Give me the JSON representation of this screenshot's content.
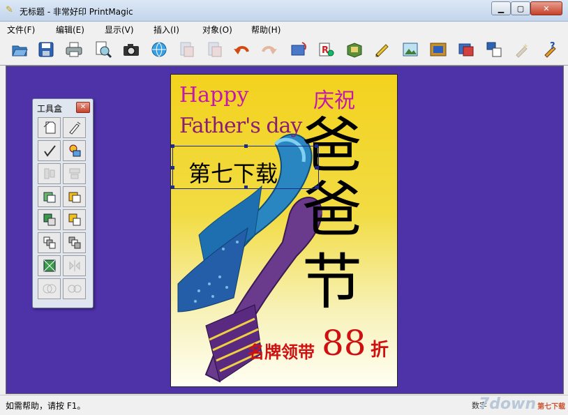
{
  "window": {
    "title": "无标题 - 非常好印 PrintMagic",
    "app_icon": "printmagic-app-icon"
  },
  "menu": {
    "items": [
      "文件(F)",
      "编辑(E)",
      "显示(V)",
      "插入(I)",
      "对象(O)",
      "帮助(H)"
    ]
  },
  "toolbar": {
    "buttons": [
      "open-icon",
      "save-icon",
      "print-icon",
      "print-preview-icon",
      "camera-icon",
      "web-icon",
      "cut-icon",
      "copy-icon",
      "undo-icon",
      "redo-icon",
      "rotate-icon",
      "text-effect-icon",
      "calendar-icon",
      "edit-icon",
      "image-icon",
      "frame-icon",
      "photo-icon",
      "layout-icon",
      "wizard-icon",
      "help-icon"
    ]
  },
  "toolbox": {
    "title": "工具盒",
    "tools": [
      "select-icon",
      "pen-icon",
      "line-icon",
      "shape-icon",
      "align-left-icon",
      "align-top-icon",
      "group-icon",
      "ungroup-icon",
      "bring-front-icon",
      "send-back-icon",
      "forward-icon",
      "backward-icon",
      "crop-icon",
      "flip-icon",
      "merge-icon",
      "split-icon"
    ]
  },
  "canvas": {
    "happy": "Happy",
    "qingzhu": "庆祝",
    "fathers_day": "Father's day",
    "selected_text": "第七下载",
    "ba1": "爸",
    "ba2": "爸",
    "jie": "节",
    "brand": "名牌领带",
    "discount_number": "88",
    "discount_unit": "折"
  },
  "status": {
    "help_text": "如需帮助，请按 F1。",
    "right_text": "数字"
  },
  "watermark": {
    "text": "7down",
    "suffix": "第七下载"
  },
  "colors": {
    "workspace": "#4d32a8",
    "title_text": "#c21aa8",
    "discount": "#d01010"
  }
}
